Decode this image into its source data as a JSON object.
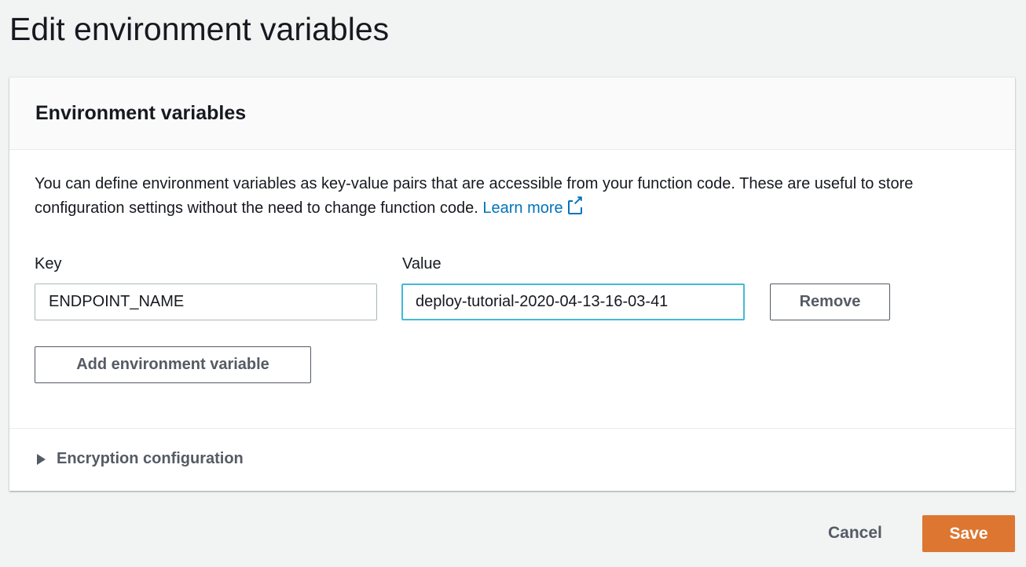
{
  "page": {
    "title": "Edit environment variables"
  },
  "panel": {
    "heading": "Environment variables",
    "description": "You can define environment variables as key-value pairs that are accessible from your function code. These are useful to store configuration settings without the need to change function code.",
    "learn_more": "Learn more",
    "key_label": "Key",
    "value_label": "Value",
    "variables": [
      {
        "key": "ENDPOINT_NAME",
        "value": "deploy-tutorial-2020-04-13-16-03-41"
      }
    ],
    "remove_label": "Remove",
    "add_label": "Add environment variable",
    "encryption_label": "Encryption configuration"
  },
  "footer": {
    "cancel": "Cancel",
    "save": "Save"
  },
  "colors": {
    "accent": "#dd7631",
    "link": "#0073bb",
    "focus": "#44b9d6"
  }
}
